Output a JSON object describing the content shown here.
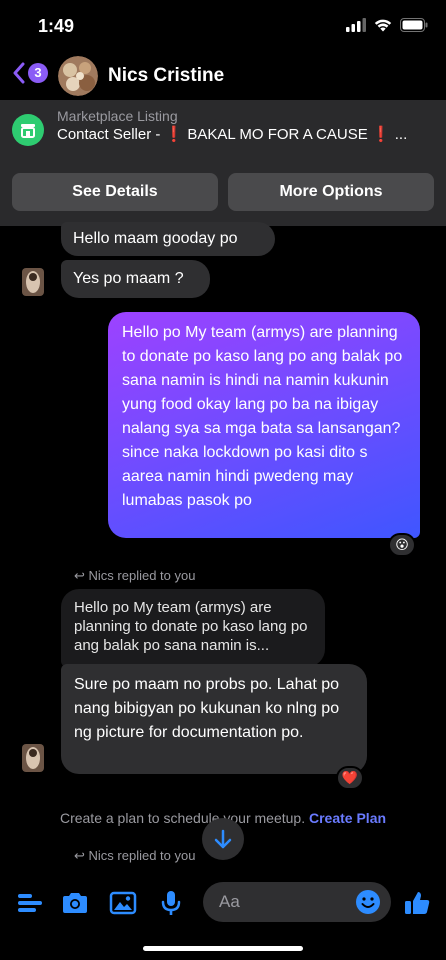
{
  "status": {
    "time": "1:49"
  },
  "header": {
    "back_badge": "3",
    "contact_name": "Nics Cristine"
  },
  "listing": {
    "label": "Marketplace Listing",
    "title_prefix": "Contact Seller - ",
    "title_mark": "❗",
    "title_body": " BAKAL MO FOR A CAUSE ",
    "title_suffix": " ...",
    "see_details": "See Details",
    "more_options": "More Options"
  },
  "messages": {
    "incoming_1": "Hello maam gooday po",
    "incoming_2": "Yes po maam ?",
    "outgoing_1": "Hello po My team (armys) are planning to donate po kaso lang po ang balak po sana namin is hindi na namin kukunin yung food okay lang po ba na ibigay nalang sya sa mga bata sa lansangan? since naka lockdown po kasi dito s aarea namin hindi pwedeng may lumabas pasok po",
    "outgoing_1_reaction": "😮",
    "reply_label_1": "Nics replied to you",
    "quoted_text": "Hello po My team (armys) are planning to donate po kaso lang po ang balak po sana namin is...",
    "incoming_3": "Sure po maam no probs po. Lahat po nang bibigyan po kukunan ko nlng po ng picture for documentation po.",
    "incoming_3_reaction": "❤️",
    "reply_label_2": "Nics replied to you"
  },
  "plan": {
    "text": "Create a plan to schedule your meetup. ",
    "link": "Create Plan"
  },
  "composer": {
    "placeholder": "Aa"
  },
  "colors": {
    "accent": "#6a7bff",
    "outgoing_start": "#9d42ff",
    "outgoing_end": "#3f56ff",
    "incoming_bg": "#2f2f31",
    "icon_blue": "#2d8cff"
  }
}
